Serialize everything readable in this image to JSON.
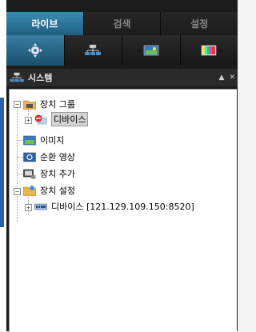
{
  "tabs": [
    {
      "label": "라이브",
      "active": true
    },
    {
      "label": "검색",
      "active": false
    },
    {
      "label": "설정",
      "active": false
    }
  ],
  "toolbar": {
    "icons": [
      "ptz-joystick-icon",
      "network-tree-icon",
      "image-screen-icon",
      "color-bars-icon"
    ]
  },
  "panel": {
    "title": "시스템",
    "controls": [
      "pin-up-icon",
      "close-icon"
    ]
  },
  "tree": {
    "device_group": "장치 그룹",
    "device": "디바이스",
    "image": "이미지",
    "sequence": "순환 영상",
    "add_device": "장치 추가",
    "device_settings": "장치 설정",
    "device_address": "디바이스 [121.129.109.150:8520]"
  },
  "colors": {
    "active_tab": "#2f7aa3",
    "panel_bg": "#1c1c1c",
    "left_accent": "#2f5fa8",
    "tree_bg": "#ffffff"
  }
}
